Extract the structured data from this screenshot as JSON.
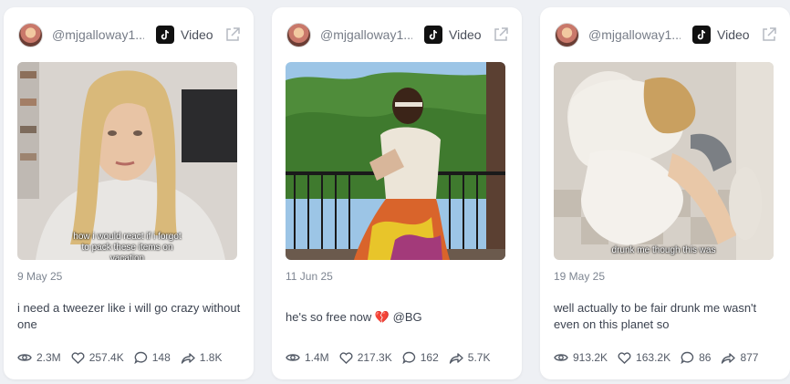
{
  "cards": [
    {
      "handle": "@mjgalloway1...",
      "platform_label": "Video",
      "platform_icon": "tiktok-icon",
      "thumbnail_caption_line1": "how i would react if i forgot",
      "thumbnail_caption_line2": "to pack these items on",
      "thumbnail_caption_line3": "vacation",
      "date": "9 May 25",
      "text": "i need a tweezer like i will go crazy without one",
      "views": "2.3M",
      "likes": "257.4K",
      "comments": "148",
      "shares": "1.8K"
    },
    {
      "handle": "@mjgalloway1...",
      "platform_label": "Video",
      "platform_icon": "tiktok-icon",
      "date": "11 Jun 25",
      "text": "he's so free now 💔 @BG",
      "views": "1.4M",
      "likes": "217.3K",
      "comments": "162",
      "shares": "5.7K"
    },
    {
      "handle": "@mjgalloway1...",
      "platform_label": "Video",
      "platform_icon": "tiktok-icon",
      "thumbnail_caption_line1": "drunk me though this was",
      "date": "19 May 25",
      "text": "well actually to be fair drunk me wasn't even on this planet so",
      "views": "913.2K",
      "likes": "163.2K",
      "comments": "86",
      "shares": "877"
    }
  ],
  "colors": {
    "page_bg": "#eef0f4",
    "card_bg": "#ffffff",
    "muted_text": "#7d8591",
    "body_text": "#3c4350"
  }
}
